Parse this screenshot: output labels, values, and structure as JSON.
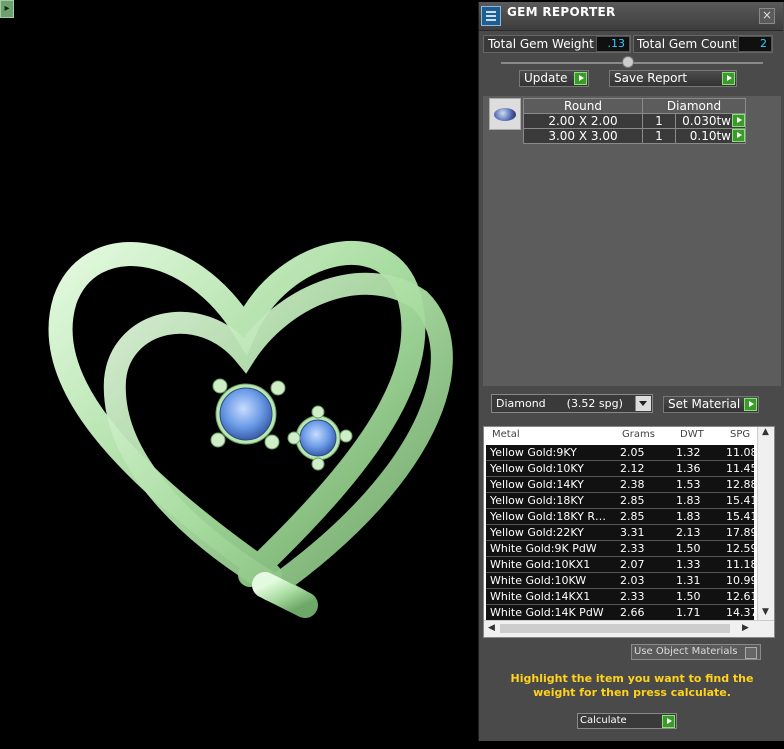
{
  "window": {
    "title": "GEM REPORTER",
    "close_icon": "close-icon"
  },
  "totals": {
    "gem_weight_label": "Total Gem Weight",
    "gem_weight_value": ".13",
    "gem_count_label": "Total Gem Count",
    "gem_count_value": "2"
  },
  "toolbar": {
    "update_label": "Update",
    "save_label": "Save Report"
  },
  "gems": {
    "header": {
      "shape": "Round",
      "material": "Diamond"
    },
    "rows": [
      {
        "size": "2.00 X 2.00",
        "count": "1",
        "weight": "0.030tw"
      },
      {
        "size": "3.00 X 3.00",
        "count": "1",
        "weight": "0.10tw"
      }
    ]
  },
  "material": {
    "selected": "Diamond      (3.52 spg)",
    "set_label": "Set Material"
  },
  "metals": {
    "columns": [
      "Metal",
      "Grams",
      "DWT",
      "SPG"
    ],
    "rows": [
      [
        "Yellow Gold:9KY",
        "2.05",
        "1.32",
        "11.08"
      ],
      [
        "Yellow Gold:10KY",
        "2.12",
        "1.36",
        "11.45"
      ],
      [
        "Yellow Gold:14KY",
        "2.38",
        "1.53",
        "12.88"
      ],
      [
        "Yellow Gold:18KY",
        "2.85",
        "1.83",
        "15.41"
      ],
      [
        "Yellow Gold:18KY R…",
        "2.85",
        "1.83",
        "15.41"
      ],
      [
        "Yellow Gold:22KY",
        "3.31",
        "2.13",
        "17.89"
      ],
      [
        "White Gold:9K PdW",
        "2.33",
        "1.50",
        "12.59"
      ],
      [
        "White Gold:10KX1",
        "2.07",
        "1.33",
        "11.18"
      ],
      [
        "White Gold:10KW",
        "2.03",
        "1.31",
        "10.99"
      ],
      [
        "White Gold:14KX1",
        "2.33",
        "1.50",
        "12.61"
      ],
      [
        "White Gold:14K PdW",
        "2.66",
        "1.71",
        "14.37"
      ]
    ]
  },
  "options": {
    "use_object_materials": "Use Object Materials"
  },
  "hint": "Highlight the item you want to find the weight for then press calculate.",
  "calculate_label": "Calculate",
  "colors": {
    "metal": "#b8e8b0",
    "gem": "#6fa0e8",
    "accent_value": "#33ccff",
    "hint": "#ffd21c"
  }
}
